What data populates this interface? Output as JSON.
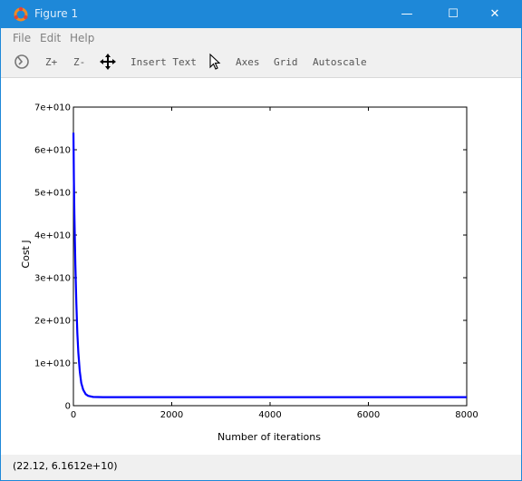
{
  "window": {
    "title": "Figure 1",
    "minimize": "—",
    "maximize": "☐",
    "close": "✕"
  },
  "menu": [
    "File",
    "Edit",
    "Help"
  ],
  "toolbar": {
    "zoom_in": "Z+",
    "zoom_out": "Z-",
    "insert_text": "Insert Text",
    "axes": "Axes",
    "grid": "Grid",
    "autoscale": "Autoscale"
  },
  "status": {
    "coords": "(22.12, 6.1612e+10)"
  },
  "chart_data": {
    "type": "line",
    "title": "",
    "xlabel": "Number of iterations",
    "ylabel": "Cost J",
    "xlim": [
      0,
      8000
    ],
    "ylim": [
      0,
      70000000000
    ],
    "xticks": [
      0,
      2000,
      4000,
      6000,
      8000
    ],
    "xtick_labels": [
      "0",
      "2000",
      "4000",
      "6000",
      "8000"
    ],
    "yticks": [
      0,
      10000000000,
      20000000000,
      30000000000,
      40000000000,
      50000000000,
      60000000000,
      70000000000
    ],
    "ytick_labels": [
      "0",
      "1e+010",
      "2e+010",
      "3e+010",
      "4e+010",
      "5e+010",
      "6e+010",
      "7e+010"
    ],
    "grid": false,
    "series": [
      {
        "color": "#0000ff",
        "x": [
          1,
          10,
          20,
          40,
          60,
          80,
          100,
          130,
          160,
          200,
          250,
          300,
          400,
          600,
          1000,
          2000,
          4000,
          6000,
          8000
        ],
        "y": [
          64000000000,
          53000000000,
          45000000000,
          33000000000,
          24000000000,
          17000000000,
          12500000000,
          8000000000,
          5300000000,
          3700000000,
          2700000000,
          2300000000,
          2050000000,
          2000000000,
          2000000000,
          2000000000,
          2000000000,
          2000000000,
          2000000000
        ]
      }
    ]
  }
}
